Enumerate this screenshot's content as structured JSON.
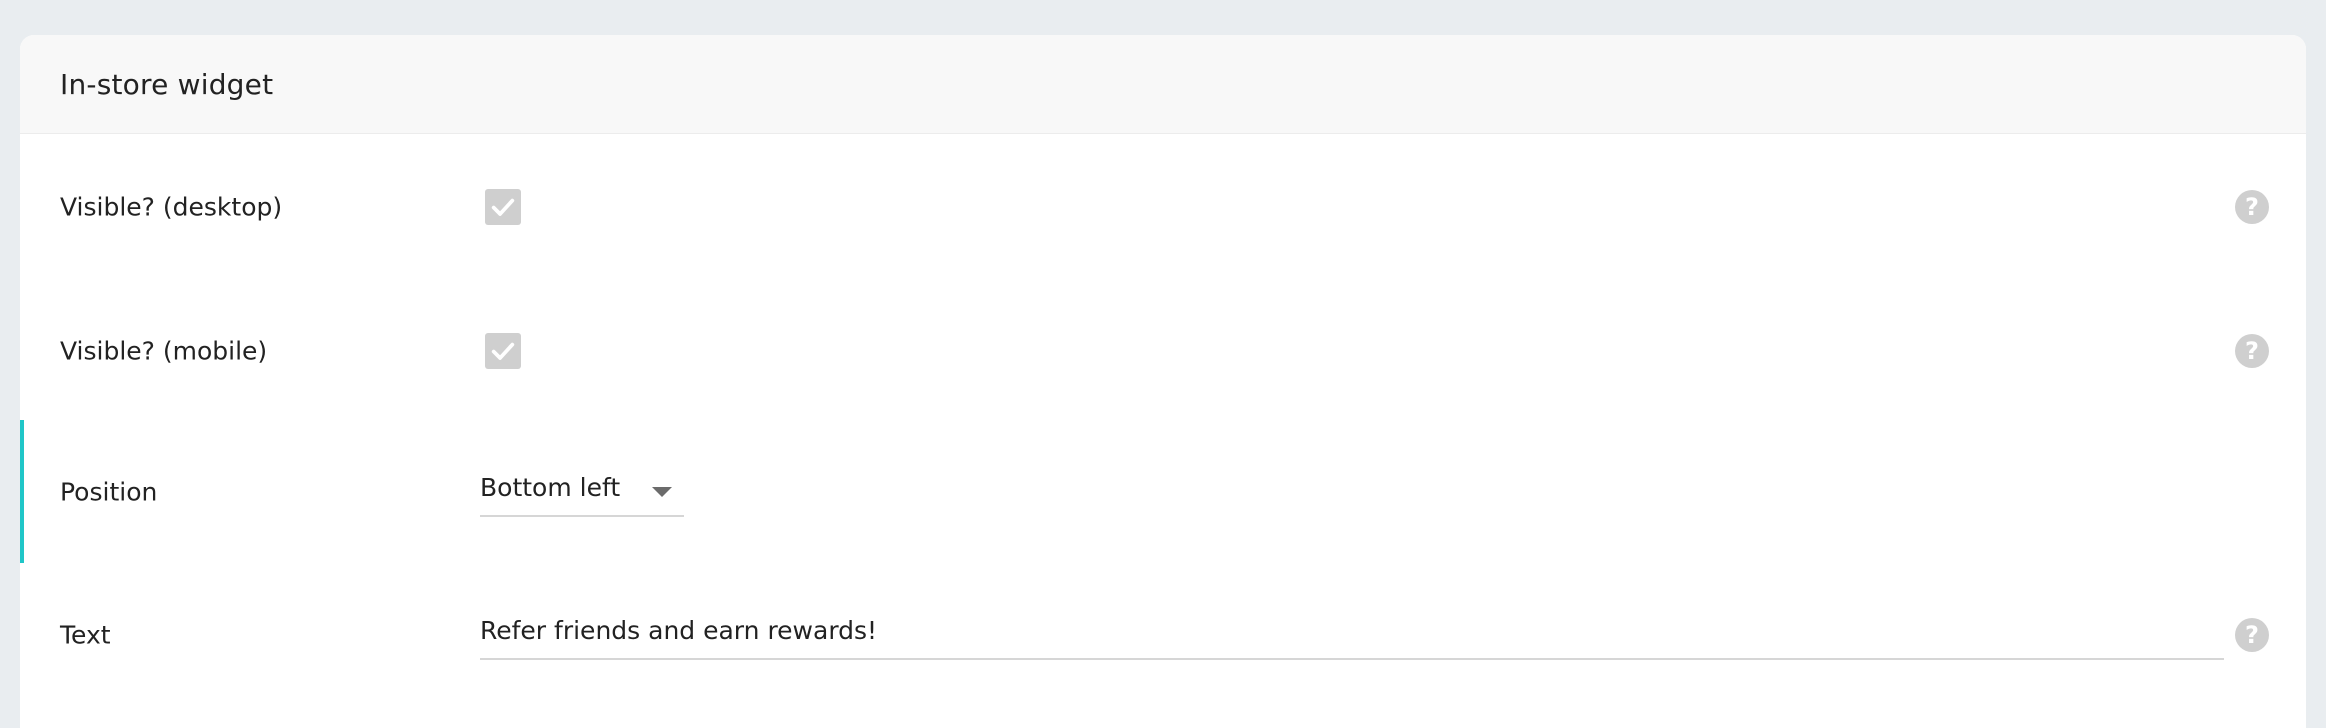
{
  "widget": {
    "title": "In-store widget",
    "rows": {
      "visible_desktop": {
        "label": "Visible? (desktop)",
        "checked": true,
        "help": "?"
      },
      "visible_mobile": {
        "label": "Visible? (mobile)",
        "checked": true,
        "help": "?"
      },
      "position": {
        "label": "Position",
        "value": "Bottom left"
      },
      "text": {
        "label": "Text",
        "value": "Refer friends and earn rewards!",
        "help": "?"
      }
    }
  },
  "colors": {
    "page_background": "#e9edf0",
    "accent": "#1fc6c8",
    "control_gray": "#cfcfcf"
  },
  "icons": {
    "checkbox_check": "check-icon",
    "help": "question-icon",
    "dropdown": "caret-down-icon"
  }
}
